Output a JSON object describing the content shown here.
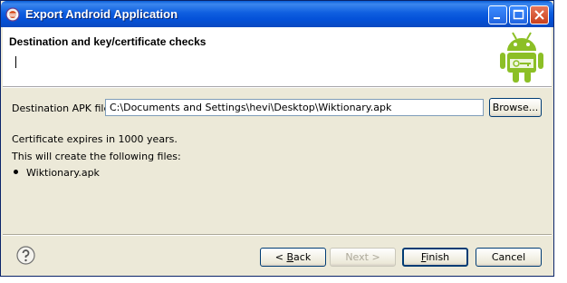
{
  "window": {
    "title": "Export Android Application",
    "controls": [
      "minimize",
      "maximize",
      "close"
    ]
  },
  "banner": {
    "title": "Destination and key/certificate checks",
    "icon": "android-robot-icon"
  },
  "form": {
    "destination_label": "Destination APK file:",
    "destination_value": "C:\\Documents and Settings\\hevi\\Desktop\\Wiktionary.apk",
    "browse_label": "Browse..."
  },
  "info": {
    "certificate_text": "Certificate expires in 1000 years.",
    "will_create_text": "This will create the following files:",
    "files": [
      "Wiktionary.apk"
    ]
  },
  "footer": {
    "back_prefix": "< ",
    "back_mnemonic": "B",
    "back_rest": "ack",
    "next_label": "Next >",
    "finish_mnemonic": "F",
    "finish_rest": "inish",
    "cancel_label": "Cancel"
  }
}
